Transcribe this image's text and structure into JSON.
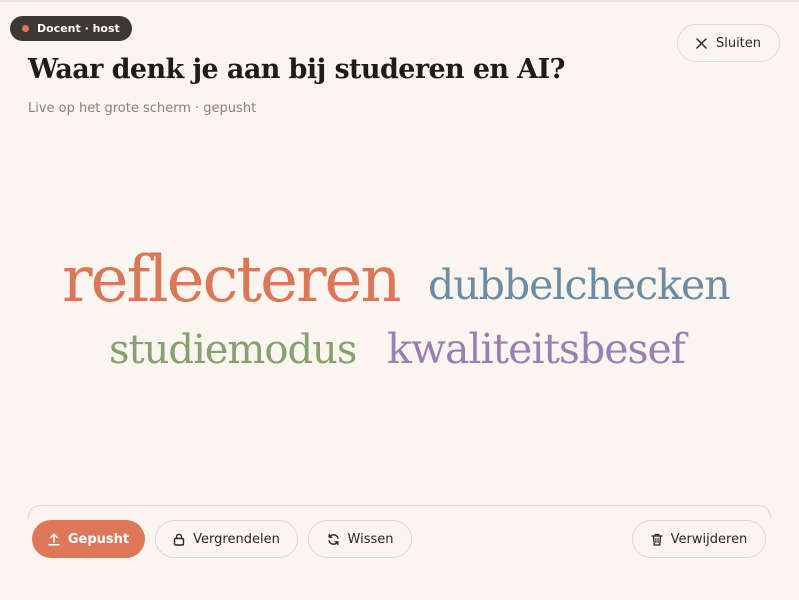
{
  "badge": {
    "label": "Docent · host",
    "dot_color": "#de7758"
  },
  "header": {
    "close_label": "Sluiten",
    "title": "Waar denk je aan bij studeren en AI?",
    "subtitle": "Live op het grote scherm · gepusht"
  },
  "word_cloud": {
    "words": [
      {
        "text": "reflecteren",
        "color": "#db7657"
      },
      {
        "text": "dubbelchecken",
        "color": "#6b8ca6"
      },
      {
        "text": "studiemodus",
        "color": "#86a06f"
      },
      {
        "text": "kwaliteitsbesef",
        "color": "#9a7fb5"
      }
    ]
  },
  "toolbar": {
    "push_label": "Gepusht",
    "lock_label": "Vergrendelen",
    "wipe_label": "Wissen",
    "delete_label": "Verwijderen",
    "accent": "#de7758"
  },
  "icons": {
    "close": "close-icon",
    "push": "upload-icon",
    "lock": "lock-icon",
    "wipe": "refresh-icon",
    "delete": "trash-icon"
  }
}
